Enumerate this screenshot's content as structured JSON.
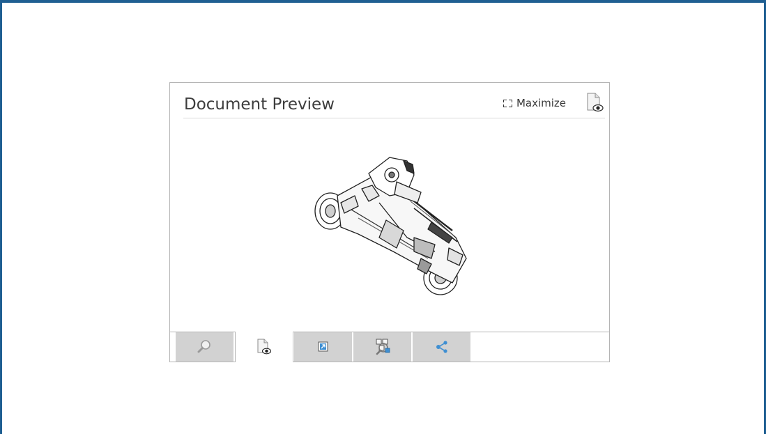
{
  "panel": {
    "title": "Document Preview",
    "maximize_label": "Maximize"
  },
  "icons": {
    "maximize": "maximize-icon",
    "document_preview": "document-preview-icon",
    "search": "search-icon",
    "shortcut": "shortcut-icon",
    "where_used": "where-used-icon",
    "share": "share-icon"
  },
  "tabs": [
    {
      "icon": "search-icon",
      "active": false
    },
    {
      "icon": "document-preview-icon",
      "active": true
    },
    {
      "icon": "shortcut-icon",
      "active": false
    },
    {
      "icon": "where-used-icon",
      "active": false
    },
    {
      "icon": "share-icon",
      "active": false
    }
  ],
  "colors": {
    "frame_border": "#1f5f92",
    "tab_inactive": "#d2d2d2",
    "accent_blue": "#3f8fd2"
  }
}
